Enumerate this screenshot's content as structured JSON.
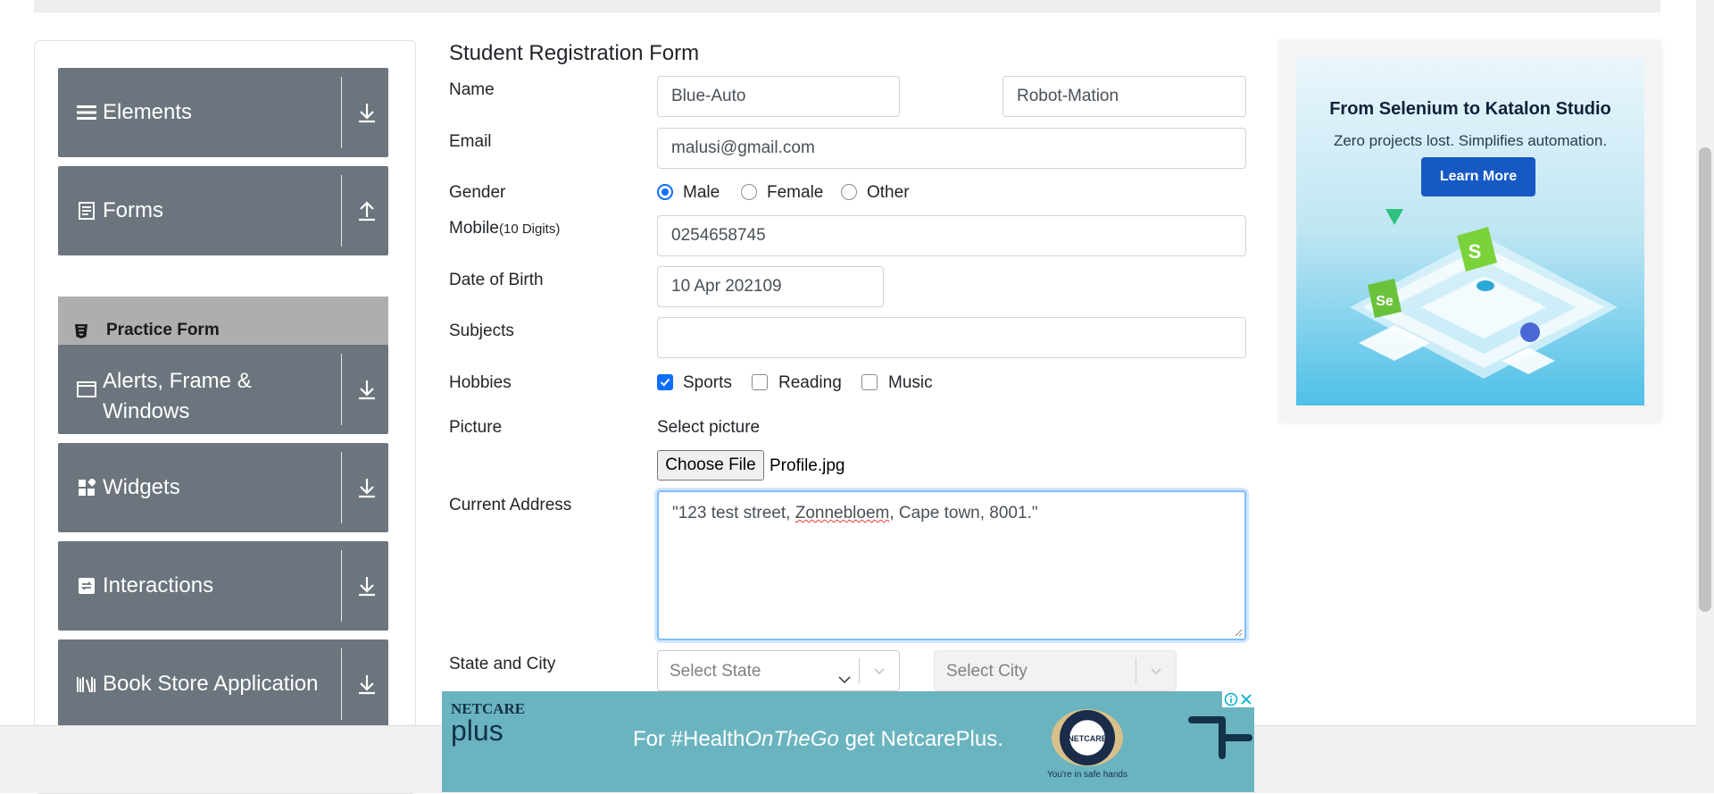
{
  "sidebar": {
    "groups": [
      {
        "label": "Elements",
        "icon": "menu-icon",
        "expanded": false
      },
      {
        "label": "Forms",
        "icon": "document-icon",
        "expanded": true
      },
      {
        "label": "Alerts, Frame &\nWindows",
        "icon": "window-icon",
        "expanded": false
      },
      {
        "label": "Widgets",
        "icon": "widgets-icon",
        "expanded": false
      },
      {
        "label": "Interactions",
        "icon": "interactions-icon",
        "expanded": false
      },
      {
        "label": "Book Store Application",
        "icon": "books-icon",
        "expanded": false
      }
    ],
    "subitems": [
      {
        "label": "Practice Form",
        "icon": "html5-icon",
        "active": true
      }
    ]
  },
  "form": {
    "title": "Student Registration Form",
    "labels": {
      "name": "Name",
      "email": "Email",
      "gender": "Gender",
      "mobile": "Mobile",
      "mobile_hint": "(10 Digits)",
      "dob": "Date of Birth",
      "subjects": "Subjects",
      "hobbies": "Hobbies",
      "picture": "Picture",
      "address": "Current Address",
      "state_city": "State and City"
    },
    "first_name": "Blue-Auto",
    "last_name": "Robot-Mation",
    "email": "malusi@gmail.com",
    "gender_options": [
      "Male",
      "Female",
      "Other"
    ],
    "gender_selected": "Male",
    "mobile": "0254658745",
    "dob": "10 Apr 202109",
    "subjects": "",
    "hobbies": [
      {
        "label": "Sports",
        "checked": true
      },
      {
        "label": "Reading",
        "checked": false
      },
      {
        "label": "Music",
        "checked": false
      }
    ],
    "picture_prompt": "Select picture",
    "file_button": "Choose File",
    "file_name": "Profile.jpg",
    "address_parts": {
      "before": "\"123 test street, ",
      "misspelled": "Zonnebloem",
      "after": ", Cape town, 8001.\""
    },
    "state_placeholder": "Select State",
    "city_placeholder": "Select City"
  },
  "ad_right": {
    "title": "From Selenium to Katalon Studio",
    "subtitle": "Zero projects lost. Simplifies automation.",
    "button": "Learn More"
  },
  "ad_bottom": {
    "brand_top": "NETCARE",
    "brand_bottom": "plus",
    "message_parts": [
      "For #Health",
      "OnTheGo",
      " get NetcarePlus."
    ],
    "seal_text": "NETCARE",
    "tagline": "You're in safe hands"
  },
  "colors": {
    "sidebar_group": "#6c757d",
    "sidebar_active": "#aeaeae",
    "accent": "#0d6efd",
    "ad_button": "#1659c5",
    "banner": "#6ab4bf"
  }
}
